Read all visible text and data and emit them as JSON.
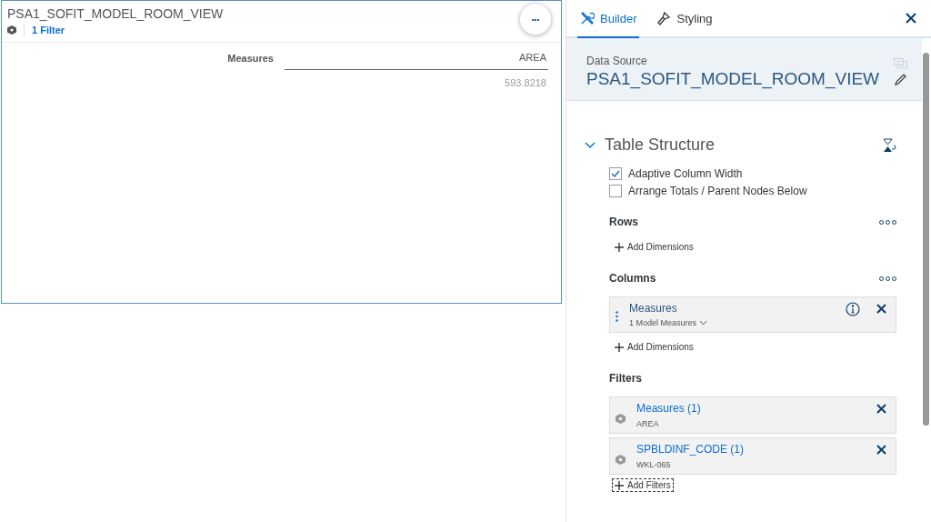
{
  "widget": {
    "title": "PSA1_SOFIT_MODEL_ROOM_VIEW",
    "filter_link": "1 Filter",
    "more_button": "•••",
    "table": {
      "row_header": "Measures",
      "column_header": "AREA",
      "value": "593.8218"
    }
  },
  "panel": {
    "tabs": [
      {
        "label": "Builder",
        "selected": true,
        "kind": "tools"
      },
      {
        "label": "Styling",
        "kind": "brush",
        "selected": false
      }
    ],
    "data_source": {
      "label": "Data Source",
      "name": "PSA1_SOFIT_MODEL_ROOM_VIEW"
    },
    "section": {
      "title": "Table Structure",
      "expanded": true
    },
    "options": [
      {
        "label": "Adaptive Column Width",
        "checked": true
      },
      {
        "label": "Arrange Totals / Parent Nodes Below",
        "checked": false
      }
    ],
    "rows": {
      "title": "Rows",
      "add": "Add Dimensions"
    },
    "columns": {
      "title": "Columns",
      "items": [
        {
          "name": "Measures",
          "detail": "1 Model Measures"
        }
      ],
      "add": "Add Dimensions"
    },
    "filters": {
      "title": "Filters",
      "items": [
        {
          "name": "Measures (1)",
          "value": "AREA"
        },
        {
          "name": "SPBLDINF_CODE (1)",
          "value": "WKL-065"
        }
      ],
      "add": "Add Filters"
    }
  }
}
